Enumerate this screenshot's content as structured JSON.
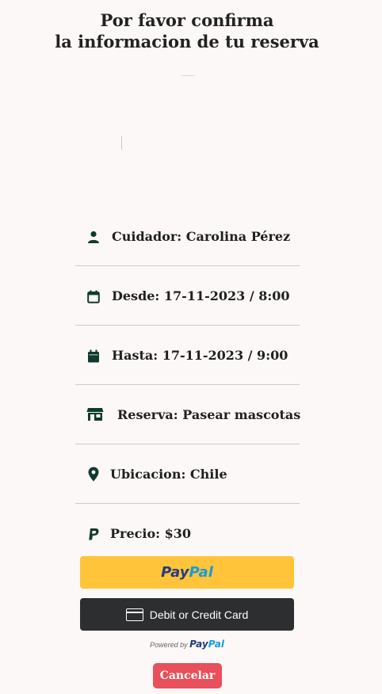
{
  "header": {
    "title_line1": "Por favor confirma",
    "title_line2": "la informacion de tu reserva"
  },
  "details": [
    {
      "icon": "person-icon",
      "label": "Cuidador: Carolina Pérez"
    },
    {
      "icon": "calendar-outline-icon",
      "label": "Desde: 17-11-2023 / 8:00"
    },
    {
      "icon": "calendar-filled-icon",
      "label": "Hasta: 17-11-2023 / 9:00"
    },
    {
      "icon": "store-icon",
      "label": "Reserva: Pasear mascotas"
    },
    {
      "icon": "location-pin-icon",
      "label": "Ubicacion: Chile"
    },
    {
      "icon": "paypal-icon",
      "label": "Precio: $30"
    }
  ],
  "payment": {
    "paypal_pay": "Pay",
    "paypal_pal": "Pal",
    "card_label": "Debit or Credit Card",
    "powered_by": "Powered by",
    "powered_pay": "Pay",
    "powered_pal": "Pal"
  },
  "actions": {
    "cancel_label": "Cancelar"
  },
  "colors": {
    "icon": "#0f3b2e",
    "paypal_yellow": "#ffc439",
    "card_dark": "#2c2e2f",
    "cancel_red": "#e8505b"
  }
}
